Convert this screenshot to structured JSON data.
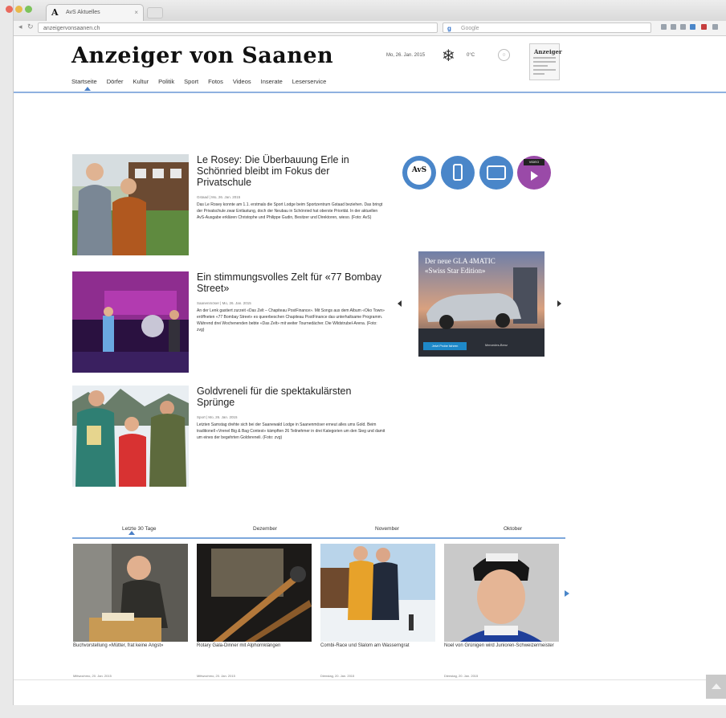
{
  "browser": {
    "tab_title": "AvS Aktuelles",
    "tab_favicon": "A",
    "close_glyph": "×",
    "url": "anzeigervonsaanen.ch",
    "search_placeholder": "Google",
    "search_engine_glyph": "g",
    "back_glyph": "◂",
    "reload_glyph": "↻"
  },
  "header": {
    "logo": "Anzeiger von Saanen",
    "date": "Mo, 26. Jan. 2015",
    "weather_icon": "snowflake-icon",
    "weather_glyph": "❄",
    "temperature": "0°C",
    "search_glyph": "○",
    "paper_thumb_title": "Anzeiger"
  },
  "nav": {
    "items": [
      "Startseite",
      "Dörfer",
      "Kultur",
      "Politik",
      "Sport",
      "Fotos",
      "Videos",
      "Inserate",
      "Leserservice"
    ]
  },
  "articles": [
    {
      "title": "Le Rosey: Die Überbauung Erle in Schönried bleibt im Fokus der Privatschule",
      "meta": "Gstaad  |  Mo, 26. Jan. 2015",
      "desc": "Das Le Rosey konnte am 1.1. erstmals die Sport Lodge beim Sportzentrum Gstaad beziehen. Das bringt der Privatschule zwar Entlastung, doch der Neubau in Schönried hat oberste Priorität. In der aktuellen AvS-Ausgabe erklären Christophe und Philippe Gudin, Besitzer und Direktoren, wieso. (Foto: AvS)"
    },
    {
      "title": "Ein stimmungsvolles Zelt für «77 Bombay Street»",
      "meta": "Saanenmöser  |  Mo, 26. Jan. 2015",
      "desc": "An der Lenk gastiert zurzeit «Das Zelt – Chapiteau PostFinance». Mit Songs aus dem Album «Oko Town» eröffneten «77 Bombay Street» es queerbeschen Chapiteau PostFinance das unterhaltsame Programm. Während drei Wochenenden bebte «Das Zelt» mit weiter Tournedächer. Die Wildstrubel-Arena. (Foto: zvg)"
    },
    {
      "title": "Goldvreneli für die spektakulärsten Sprünge",
      "meta": "Sport  |  Mo, 26. Jan. 2015",
      "desc": "Letzten Samstag drehte sich bei der Saanewald Lodge in Saanenmöser erneut alles ums Gold. Beim traditionell «Vrenel Big & Bag Contest» kämpften 26 Teilnehmer in drei Kategorien um den Sieg und damit um eines der begehrten Goldvreneli. (Foto: zvg)"
    }
  ],
  "apps": [
    {
      "name": "avs-logo-app",
      "label": "AvS"
    },
    {
      "name": "smartphone-app",
      "label": ""
    },
    {
      "name": "tablet-app",
      "label": ""
    },
    {
      "name": "video-app",
      "label": "VIDEO"
    }
  ],
  "ad": {
    "headline_line1": "Der neue GLA 4MATIC",
    "headline_line2": "«Swiss Star Edition»",
    "button": "Jetzt Probe fahren",
    "brand": "Mercedes-Benz"
  },
  "archive_tabs": [
    "Letzte 30 Tage",
    "Dezember",
    "November",
    "Oktober"
  ],
  "cards": [
    {
      "caption": "Buchvorstellung «Mütter, frat keine Angst»",
      "date": "Mittwochmo, 20. Jan. 2015"
    },
    {
      "caption": "Rotary Gala-Dinner mit Alphornklängen",
      "date": "Mittwochmo, 20. Jan. 2015"
    },
    {
      "caption": "Combi-Race und Slalom am Wasserngrat",
      "date": "Dienstag, 20. Jan. 2015"
    },
    {
      "caption": "Noel von Grünigen wird Junioren-Schweizermeister",
      "date": "Dienstag, 20. Jan. 2015"
    }
  ],
  "colors": {
    "accent": "#4a86c9",
    "nav_line": "#8fb1e0"
  }
}
